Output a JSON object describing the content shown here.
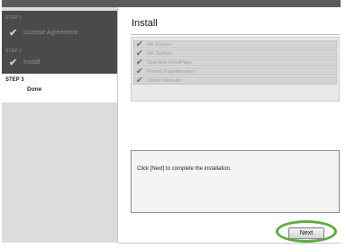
{
  "sidebar": {
    "steps": [
      {
        "number": "STEP 1",
        "name": "License Agreement",
        "done": true
      },
      {
        "number": "STEP 2",
        "name": "Install",
        "done": true
      },
      {
        "number": "STEP 3",
        "name": "Done",
        "done": false
      }
    ]
  },
  "main": {
    "title": "Install",
    "components": [
      "MF Drivers",
      "MF Toolbox",
      "ScanSoft OmniPage",
      "Presto! PageManager",
      "Online Manuals"
    ],
    "message": "Click [Next] to complete the installation.",
    "next_label": "Next"
  },
  "colors": {
    "highlight_ring": "#5cab3e",
    "sidebar_completed": "#4a4a4a"
  }
}
